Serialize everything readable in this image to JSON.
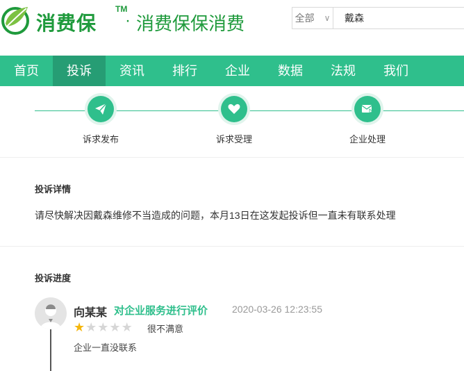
{
  "header": {
    "logo_text": "消费保",
    "logo_tm": "TM",
    "logo_dot": "·",
    "slogan": "消费保保消费",
    "search_scope": "全部",
    "search_value": "戴森"
  },
  "nav": {
    "items": [
      {
        "label": "首页"
      },
      {
        "label": "投诉"
      },
      {
        "label": "资讯"
      },
      {
        "label": "排行"
      },
      {
        "label": "企业"
      },
      {
        "label": "数据"
      },
      {
        "label": "法规"
      },
      {
        "label": "我们"
      }
    ],
    "active_index": 1
  },
  "steps": [
    {
      "label": "诉求发布",
      "icon": "paper-plane-icon"
    },
    {
      "label": "诉求受理",
      "icon": "heart-icon"
    },
    {
      "label": "企业处理",
      "icon": "mail-reply-icon"
    }
  ],
  "detail": {
    "title": "投诉详情",
    "text": "请尽快解决因戴森维修不当造成的问题，本月13日在这发起投诉但一直未有联系处理"
  },
  "progress": {
    "title": "投诉进度",
    "entry": {
      "user": "向某某",
      "action": "对企业服务进行评价",
      "time": "2020-03-26 12:23:55",
      "rating": 1,
      "rating_max": 5,
      "rating_text": "很不满意",
      "comment": "企业一直没联系"
    }
  },
  "colors": {
    "brand_green": "#1f9a3c",
    "accent": "#2fbf8c",
    "nav_active": "#269d74",
    "star_on": "#f5b60c"
  }
}
